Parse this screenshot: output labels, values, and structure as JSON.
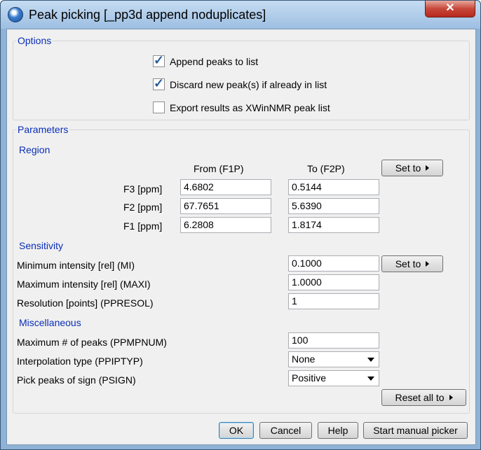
{
  "window": {
    "title": "Peak picking [_pp3d append noduplicates]",
    "close_symbol": "✕"
  },
  "options": {
    "title": "Options",
    "checkboxes": [
      {
        "label": "Append peaks to list",
        "checked": true
      },
      {
        "label": "Discard new peak(s) if already in list",
        "checked": true
      },
      {
        "label": "Export results as XWinNMR peak list",
        "checked": false
      }
    ]
  },
  "parameters": {
    "title": "Parameters",
    "region": {
      "label": "Region",
      "col_from": "From (F1P)",
      "col_to": "To (F2P)",
      "set_to": "Set to",
      "rows": [
        {
          "label": "F3 [ppm]",
          "from": "4.6802",
          "to": "0.5144"
        },
        {
          "label": "F2 [ppm]",
          "from": "67.7651",
          "to": "5.6390"
        },
        {
          "label": "F1 [ppm]",
          "from": "6.2808",
          "to": "1.8174"
        }
      ]
    },
    "sensitivity": {
      "label": "Sensitivity",
      "set_to": "Set to",
      "min_label": "Minimum intensity [rel] (MI)",
      "min_value": "0.1000",
      "max_label": "Maximum intensity [rel] (MAXI)",
      "max_value": "1.0000",
      "res_label": "Resolution [points] (PPRESOL)",
      "res_value": "1"
    },
    "misc": {
      "label": "Miscellaneous",
      "maxpeaks_label": "Maximum # of peaks (PPMPNUM)",
      "maxpeaks_value": "100",
      "interp_label": "Interpolation type (PPIPTYP)",
      "interp_value": "None",
      "sign_label": "Pick peaks of sign (PSIGN)",
      "sign_value": "Positive",
      "reset_label": "Reset all to"
    }
  },
  "buttons": {
    "ok": "OK",
    "cancel": "Cancel",
    "help": "Help",
    "manual": "Start manual picker"
  },
  "colors": {
    "group_title": "#0a2eb8",
    "title_bar": "#9dbfe2",
    "close_button": "#c7473a"
  }
}
